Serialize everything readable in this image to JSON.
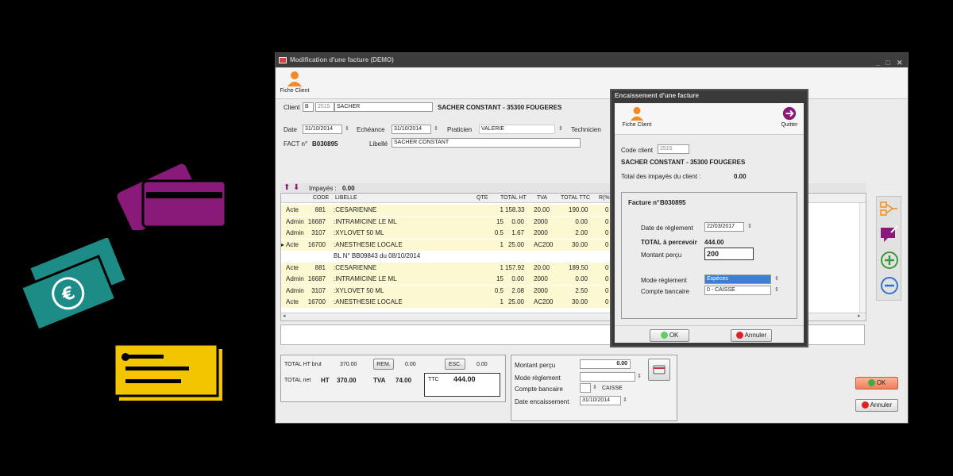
{
  "window": {
    "title": "Modification d'une facture (DEMO)",
    "controls": {
      "minimize": "_",
      "maximize": "□",
      "close": "✕"
    }
  },
  "toolbar": {
    "fiche_client": "Fiche Client"
  },
  "header": {
    "client_label": "Client",
    "client_prefix": "B",
    "client_code": "2515",
    "client_name": "SACHER",
    "client_full": "SACHER CONSTANT - 35300 FOUGERES",
    "date_label": "Date",
    "date_value": "31/10/2014",
    "echeance_label": "Echéance",
    "echeance_value": "31/10/2014",
    "praticien_label": "Praticien",
    "praticien_value": "VALERIE",
    "technicien_label": "Technicien",
    "fact_label": "FACT n°",
    "fact_value": "B030895",
    "libelle_label": "Libellé",
    "libelle_value": "SACHER CONSTANT"
  },
  "impayes": {
    "label": "Impayés :",
    "value": "0.00"
  },
  "grid": {
    "columns": {
      "code": "CODE",
      "libelle": "LIBELLE",
      "qte": "QTE",
      "total_ht": "TOTAL HT",
      "tva": "TVA",
      "total_ttc": "TOTAL TTC",
      "r": "R(%)"
    },
    "rows": [
      {
        "type": "Acte",
        "code": "881",
        "libelle": ":CESARIENNE",
        "qte": "1",
        "ht": "158.33",
        "tva": "20.00",
        "ttc": "190.00",
        "r": "0"
      },
      {
        "type": "Admin",
        "code": "16687",
        "libelle": ":INTRAMICINE LE ML",
        "qte": "15",
        "ht": "0.00",
        "tva": "2000",
        "ttc": "0.00",
        "r": "0"
      },
      {
        "type": "Admin",
        "code": "3107",
        "libelle": ":XYLOVET 50 ML",
        "qte": "0.5",
        "ht": "1.67",
        "tva": "2000",
        "ttc": "2.00",
        "r": "0"
      },
      {
        "type": "Acte",
        "code": "16700",
        "libelle": ":ANESTHESIE LOCALE",
        "qte": "1",
        "ht": "25.00",
        "tva": "AC200",
        "ttc": "30.00",
        "r": "0"
      },
      {
        "type": "",
        "code": "",
        "libelle": "BL N° BB09843 du 08/10/2014",
        "qte": "",
        "ht": "",
        "tva": "",
        "ttc": "",
        "r": ""
      },
      {
        "type": "Acte",
        "code": "881",
        "libelle": ":CESARIENNE",
        "qte": "1",
        "ht": "157.92",
        "tva": "20.00",
        "ttc": "189.50",
        "r": "0"
      },
      {
        "type": "Admin",
        "code": "16687",
        "libelle": ":INTRAMICINE LE ML",
        "qte": "15",
        "ht": "0.00",
        "tva": "2000",
        "ttc": "0.00",
        "r": "0"
      },
      {
        "type": "Admin",
        "code": "3107",
        "libelle": ":XYLOVET 50 ML",
        "qte": "0.5",
        "ht": "2.08",
        "tva": "2000",
        "ttc": "2.50",
        "r": "0"
      },
      {
        "type": "Acte",
        "code": "16700",
        "libelle": ":ANESTHESIE LOCALE",
        "qte": "1",
        "ht": "25.00",
        "tva": "AC200",
        "ttc": "30.00",
        "r": "0"
      }
    ]
  },
  "totals": {
    "ht_brut_label": "TOTAL HT brut",
    "ht_brut_value": "370.00",
    "rem_label": "REM.",
    "rem_value": "0.00",
    "esc_label": "ESC.",
    "esc_value": "0.00",
    "net_label": "TOTAL net",
    "ht_label": "HT",
    "ht_value": "370.00",
    "tva_label": "TVA",
    "tva_value": "74.00",
    "ttc_label": "TTC",
    "ttc_value": "444.00"
  },
  "payment": {
    "montant_label": "Montant perçu",
    "montant_value": "0.00",
    "mode_label": "Mode règlement",
    "mode_value": "",
    "compte_label": "Compte bancaire",
    "compte_value": "CAISSE",
    "date_label": "Date encaissement",
    "date_value": "31/10/2014"
  },
  "actions": {
    "ok": "OK",
    "annuler": "Annuler"
  },
  "dialog": {
    "title": "Encaissement d'une facture",
    "fiche_client": "Fiche Client",
    "quitter": "Quitter",
    "code_client_label": "Code client",
    "code_client_value": "2515",
    "client_full": "SACHER CONSTANT - 35300 FOUGERES",
    "impayes_label": "Total des impayés du client :",
    "impayes_value": "0.00",
    "facture_label": "Facture n°",
    "facture_value": "B030895",
    "date_label": "Date de règlement",
    "date_value": "22/03/2017",
    "total_label": "TOTAL à percevoir",
    "total_value": "444.00",
    "montant_label": "Montant perçu",
    "montant_value": "200",
    "mode_label": "Mode règlement",
    "mode_value": "Espèces",
    "compte_label": "Compte bancaire",
    "compte_value": "0 - CAISSE",
    "ok": "OK",
    "annuler": "Annuler"
  },
  "colors": {
    "purple": "#8a1a7a",
    "teal": "#1e8c86",
    "yellow": "#f2c500",
    "orange": "#f28b22",
    "row_yellow": "#fbf8d2"
  }
}
